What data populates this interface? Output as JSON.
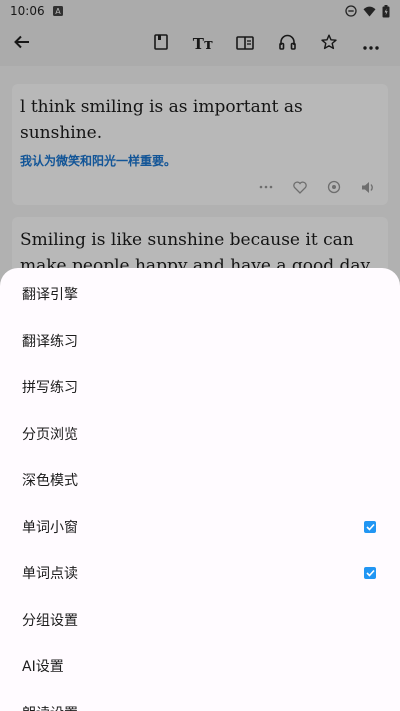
{
  "status_bar": {
    "time": "10:06"
  },
  "toolbar": {
    "icons": [
      "back-arrow-icon",
      "book-icon",
      "text-size-icon",
      "split-view-icon",
      "headphones-icon",
      "star-icon",
      "more-icon"
    ]
  },
  "sentences": [
    {
      "en": "l think smiling is as important as sunshine.",
      "zh": "我认为微笑和阳光一样重要。"
    },
    {
      "en": "Smiling is like sunshine because it can make people happy and have a good day.",
      "zh": ""
    }
  ],
  "menu": {
    "items": [
      {
        "label": "翻译引擎",
        "checked": null
      },
      {
        "label": "翻译练习",
        "checked": null
      },
      {
        "label": "拼写练习",
        "checked": null
      },
      {
        "label": "分页浏览",
        "checked": null
      },
      {
        "label": "深色模式",
        "checked": null
      },
      {
        "label": "单词小窗",
        "checked": true
      },
      {
        "label": "单词点读",
        "checked": true
      },
      {
        "label": "分组设置",
        "checked": null
      },
      {
        "label": "AI设置",
        "checked": null
      },
      {
        "label": "朗读设置",
        "checked": null
      }
    ]
  },
  "colors": {
    "accent": "#2196f3",
    "translation": "#1976d2",
    "sheet_bg": "#fffbff"
  }
}
